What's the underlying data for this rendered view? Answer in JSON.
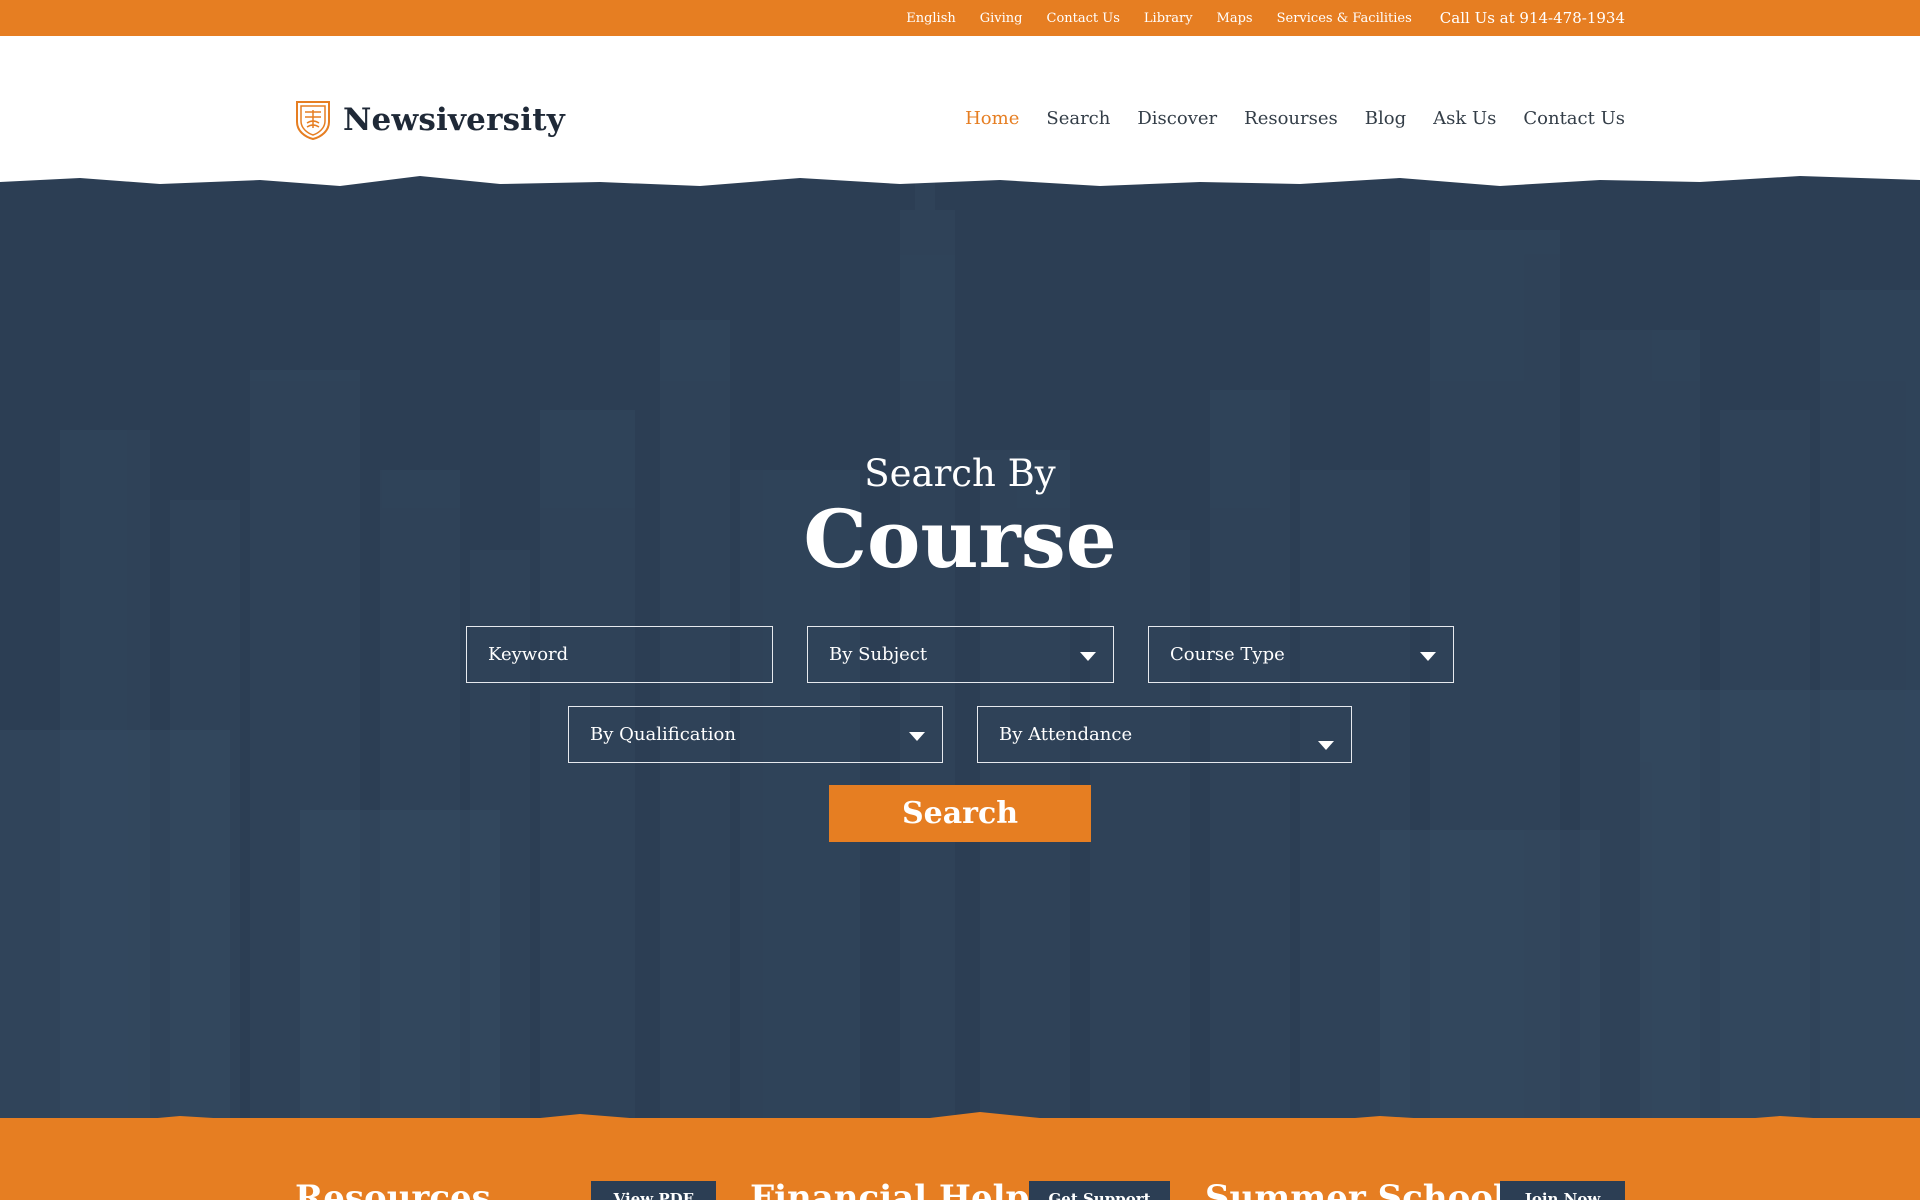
{
  "topbar": {
    "links": [
      "English",
      "Giving",
      "Contact Us",
      "Library",
      "Maps",
      "Services & Facilities"
    ],
    "phone": "Call Us at 914-478-1934"
  },
  "header": {
    "logo_text": "Newsiversity",
    "logo_icon": "shield-icon",
    "nav": [
      {
        "label": "Home",
        "active": true
      },
      {
        "label": "Search",
        "active": false
      },
      {
        "label": "Discover",
        "active": false
      },
      {
        "label": "Resourses",
        "active": false
      },
      {
        "label": "Blog",
        "active": false
      },
      {
        "label": "Ask Us",
        "active": false
      },
      {
        "label": "Contact Us",
        "active": false
      }
    ]
  },
  "hero": {
    "subtitle": "Search By",
    "title": "Course",
    "keyword_placeholder": "Keyword",
    "subject_select": "By Subject",
    "course_type_select": "Course Type",
    "qualification_select": "By Qualification",
    "attendance_select": "By Attendance",
    "search_button": "Search"
  },
  "bottom": {
    "items": [
      {
        "title": "Resources",
        "button": "View PDF"
      },
      {
        "title": "Financial Help",
        "button": "Get Support"
      },
      {
        "title": "Summer School",
        "button": "Join Now"
      }
    ]
  },
  "colors": {
    "accent": "#e67e22",
    "hero_bg": "#2c3e54",
    "text_dark": "#1f2937",
    "white": "#ffffff"
  }
}
